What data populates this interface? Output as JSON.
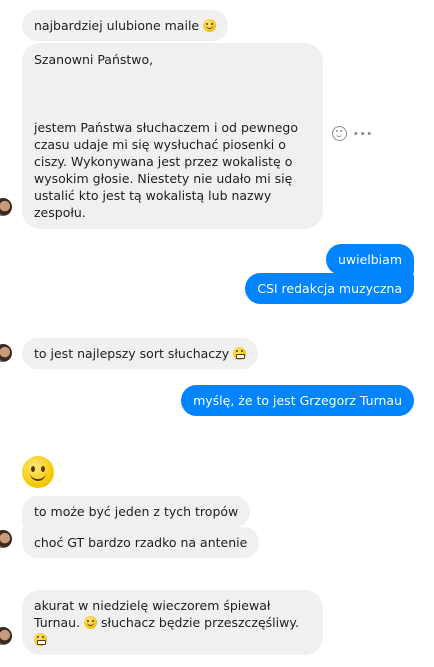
{
  "messages": {
    "m1": "najbardziej ulubione maile",
    "m2_greeting": "Szanowni Państwo,",
    "m2_body": "jestem Państwa słuchaczem i od pewnego czasu udaje mi się wysłuchać piosenki o ciszy. Wykonywana jest przez wokalistę o wysokim głosie. Niestety nie udało mi się ustalić kto jest tą wokalistą lub nazwy zespołu.",
    "m3": "uwielbiam",
    "m4": "CSI redakcja muzyczna",
    "m5": "to jest najlepszy sort słuchaczy",
    "m6": "myślę, że to jest Grzegorz Turnau",
    "m7": "to może być jeden z tych tropów",
    "m8": "choć GT bardzo rzadko na antenie",
    "m9_part1": "akurat w niedzielę wieczorem śpiewał Turnau.",
    "m9_part2": "słuchacz będzie przeszczęśliwy."
  },
  "icons": {
    "emoji_smile": "slightly-smiling-face",
    "emoji_grin": "grinning-face",
    "emoji_large": "slightly-smiling-face",
    "react": "react-smiley-icon",
    "more": "more-options-icon",
    "avatar": "user-avatar"
  },
  "colors": {
    "incoming_bubble": "#f1f0f0",
    "outgoing_bubble": "#0084ff",
    "outgoing_text": "#ffffff"
  }
}
